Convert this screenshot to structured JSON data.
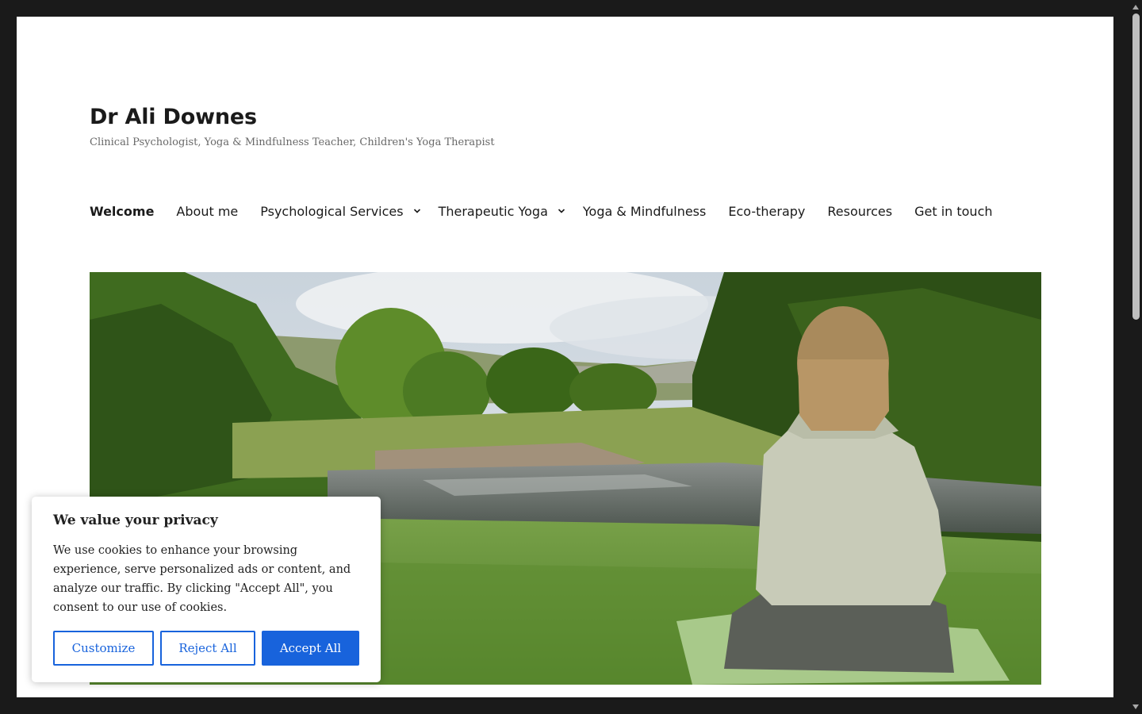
{
  "site": {
    "title": "Dr Ali Downes",
    "description": "Clinical Psychologist, Yoga & Mindfulness Teacher, Children's Yoga Therapist"
  },
  "nav": {
    "items": [
      {
        "label": "Welcome",
        "current": true,
        "has_submenu": false
      },
      {
        "label": "About me",
        "current": false,
        "has_submenu": false
      },
      {
        "label": "Psychological Services",
        "current": false,
        "has_submenu": true
      },
      {
        "label": "Therapeutic Yoga",
        "current": false,
        "has_submenu": true
      },
      {
        "label": "Yoga & Mindfulness",
        "current": false,
        "has_submenu": false
      },
      {
        "label": "Eco-therapy",
        "current": false,
        "has_submenu": false
      },
      {
        "label": "Resources",
        "current": false,
        "has_submenu": false
      },
      {
        "label": "Get in touch",
        "current": false,
        "has_submenu": false
      }
    ]
  },
  "hero": {
    "image": "meditation-by-river-photo"
  },
  "cookie_banner": {
    "title": "We value your privacy",
    "text": "We use cookies to enhance your browsing experience, serve personalized ads or content, and analyze our traffic. By clicking \"Accept All\", you consent to our use of cookies.",
    "customize_label": "Customize",
    "reject_label": "Reject All",
    "accept_label": "Accept All",
    "accent_color": "#1863dc"
  },
  "colors": {
    "frame_border": "#1a1a1a",
    "page_bg": "#ffffff",
    "text": "#1a1a1a",
    "muted_text": "#686868"
  }
}
